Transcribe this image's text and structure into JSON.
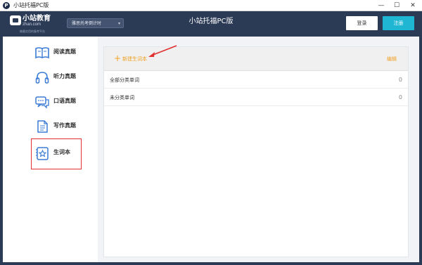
{
  "window": {
    "title": "小站托福PC版",
    "controls": {
      "minimize": "—",
      "maximize": "☐",
      "close": "✕"
    }
  },
  "header": {
    "logo": {
      "main": "小站教育",
      "sub": "zhan.com",
      "slogan": "做最实用的备考平台"
    },
    "plan_select": {
      "value": "雅思托考倒计时"
    },
    "app_title": "小站托福PC版",
    "login_label": "登录",
    "register_label": "注册"
  },
  "sidebar": {
    "items": [
      {
        "label": "阅读真题",
        "icon": "book-icon"
      },
      {
        "label": "听力真题",
        "icon": "headphones-icon"
      },
      {
        "label": "口语真题",
        "icon": "chat-bubble-icon"
      },
      {
        "label": "写作真题",
        "icon": "document-icon"
      },
      {
        "label": "生词本",
        "icon": "star-notebook-icon",
        "active": true
      }
    ]
  },
  "vocab": {
    "new_book_label": "新建生词本",
    "edit_label": "编辑",
    "rows": [
      {
        "name": "全部分类单词",
        "count": "0"
      },
      {
        "name": "未分类单词",
        "count": "0"
      }
    ]
  },
  "colors": {
    "header_bg": "#2b3a55",
    "accent_orange": "#f0a020",
    "register_blue": "#1fb6d4",
    "annotation_red": "#e03030",
    "icon_blue": "#3a7bd5"
  }
}
